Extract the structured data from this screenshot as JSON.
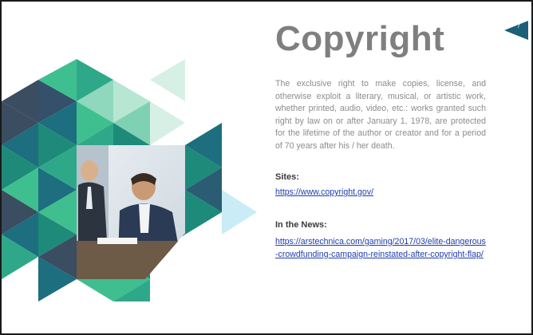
{
  "slide": {
    "page_number": "7",
    "title": "Copyright",
    "body": "The exclusive right to make copies, license, and otherwise exploit a literary, musical, or artistic work, whether printed, audio, video, etc.: works granted such right by law on or after January 1, 1978, are protected for the lifetime of the author or creator and for a period of 70 years after his / her death.",
    "sites_label": "Sites:",
    "sites_link": "https://www.copyright.gov/",
    "news_label": "In the News:",
    "news_link": "https://arstechnica.com/gaming/2017/03/elite-dangerous-crowdfunding-campaign-reinstated-after-copyright-flap/"
  },
  "decoration": {
    "photo_description_icon": "business-meeting-photo",
    "colors": {
      "dark_navy": "#3b4d60",
      "teal_dark": "#1d6e7f",
      "teal": "#1e8a7a",
      "green": "#3fbf8f",
      "mint": "#8fd8bd",
      "pale_mint": "#d7f0e6",
      "light_blue": "#c9ecf6",
      "badge": "#1b5f78"
    }
  }
}
